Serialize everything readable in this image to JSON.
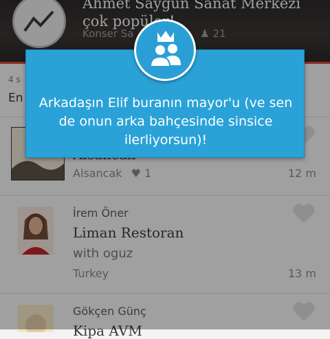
{
  "hero": {
    "title": "Ahmet Saygun Sanat Merkezi çok popüler!",
    "category": "Konser Sa",
    "count": "21"
  },
  "section": {
    "header": "4 s",
    "subheader": "En"
  },
  "items": [
    {
      "user": "",
      "venue": "Alsancak",
      "location": "Alsancak",
      "likes": "1",
      "time": "12 m"
    },
    {
      "user": "İrem Öner",
      "venue": "Liman Restoran",
      "shout": "with oguz",
      "location": "Turkey",
      "time": "13 m"
    },
    {
      "user": "Gökçen Günç",
      "venue": "Kipa AVM"
    }
  ],
  "toast": {
    "message": "Arkadaşın Elif buranın mayor'u (ve sen de onun arka bahçesinde sinsice ilerliyorsun)!",
    "icon": "mayor-crown-icon"
  },
  "colors": {
    "accent_blue": "#2aa2d8",
    "hero_line_red": "#d94437"
  }
}
